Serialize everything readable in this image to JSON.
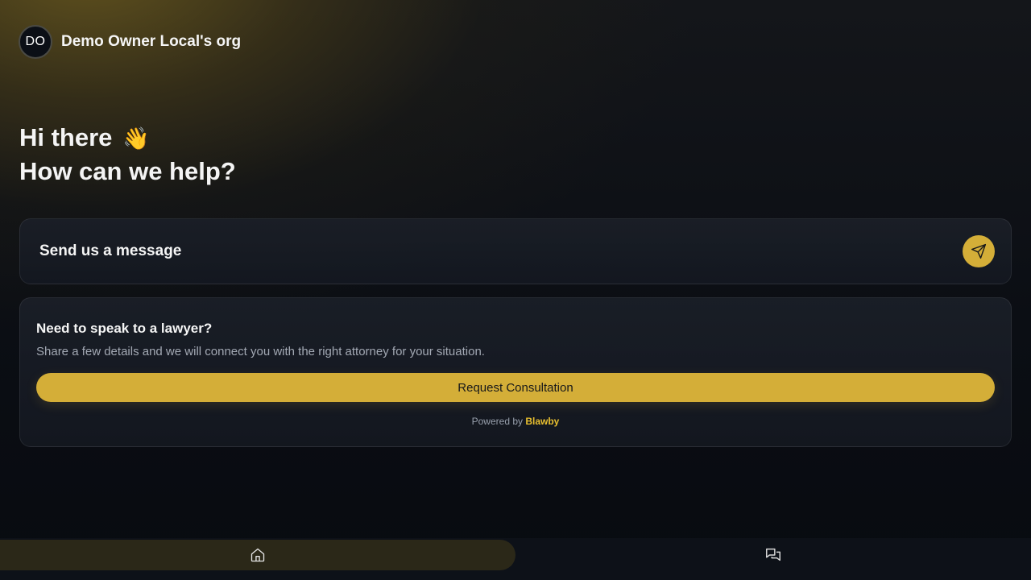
{
  "header": {
    "avatar_initials": "DO",
    "org_name": "Demo Owner Local's org"
  },
  "greeting": {
    "line1": "Hi there",
    "line2": "How can we help?",
    "emoji": "👋"
  },
  "message_card": {
    "label": "Send us a message",
    "send_icon": "send-icon"
  },
  "consultation": {
    "title": "Need to speak to a lawyer?",
    "description": "Share a few details and we will connect you with the right attorney for your situation.",
    "button_label": "Request Consultation"
  },
  "footer": {
    "powered_by_prefix": "Powered by",
    "brand": "Blawby"
  },
  "bottom_nav": {
    "items": [
      {
        "icon": "home-icon",
        "active": true
      },
      {
        "icon": "chat-icon",
        "active": false
      }
    ]
  },
  "colors": {
    "accent": "#d4ae38",
    "brand_link": "#e8bf2f",
    "background": "#0a0d13",
    "card": "#1a1e27"
  }
}
